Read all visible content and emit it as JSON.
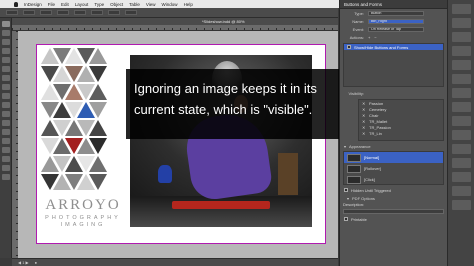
{
  "menubar": {
    "items": [
      "InDesign",
      "File",
      "Edit",
      "Layout",
      "Type",
      "Object",
      "Table",
      "View",
      "Window",
      "Help"
    ]
  },
  "document": {
    "tab_title": "*Slideshow.indd @ 80%",
    "brand_main": "ARROYO",
    "brand_sub": "PHOTOGRAPHY",
    "brand_sub2": "IMAGING"
  },
  "overlay": {
    "text": "Ignoring an image keeps it in its current state, which is \"visible\"."
  },
  "panel": {
    "title": "Buttons and Forms",
    "type_label": "Type:",
    "type_value": "Button",
    "name_label": "Name:",
    "name_value": "Btn_Right",
    "event_label": "Event:",
    "event_value": "On Release or Tap",
    "actions_label": "Actions:",
    "action_item": "Show/Hide Buttons and Forms",
    "visibility_label": "Visibility:",
    "visibility_items": [
      "Passion",
      "Cemetery",
      "Chair",
      "TR_Mallet",
      "TR_Passion",
      "TR_Lin"
    ],
    "appearance_label": "Appearance",
    "state_normal": "[Normal]",
    "state_rollover": "[Rollover]",
    "state_click": "[Click]",
    "hidden_label": "Hidden Until Triggered",
    "pdf_options_label": "PDF Options",
    "description_label": "Description:",
    "printable_label": "Printable"
  },
  "colors": {
    "accent": "#3b62c4",
    "page_border": "#b01ab0",
    "overlay_bg": "#000000"
  }
}
